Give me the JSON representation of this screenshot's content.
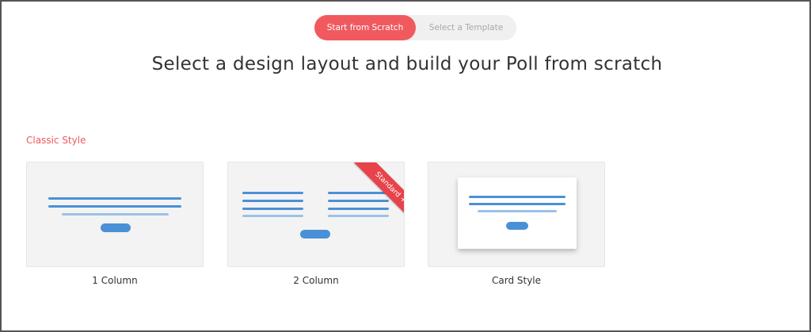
{
  "tabs": {
    "active_label": "Start from Scratch",
    "inactive_label": "Select a Template"
  },
  "heading": "Select a design layout and build your Poll from scratch",
  "section": {
    "label": "Classic Style"
  },
  "layouts": [
    {
      "caption": "1 Column"
    },
    {
      "caption": "2 Column",
      "badge": "Standard +"
    },
    {
      "caption": "Card Style"
    }
  ],
  "colors": {
    "accent": "#f05a5f",
    "ribbon": "#e8434a",
    "line_dark": "#4a90d6",
    "line_light": "#9bc2e6",
    "card_bg": "#f3f3f3"
  }
}
